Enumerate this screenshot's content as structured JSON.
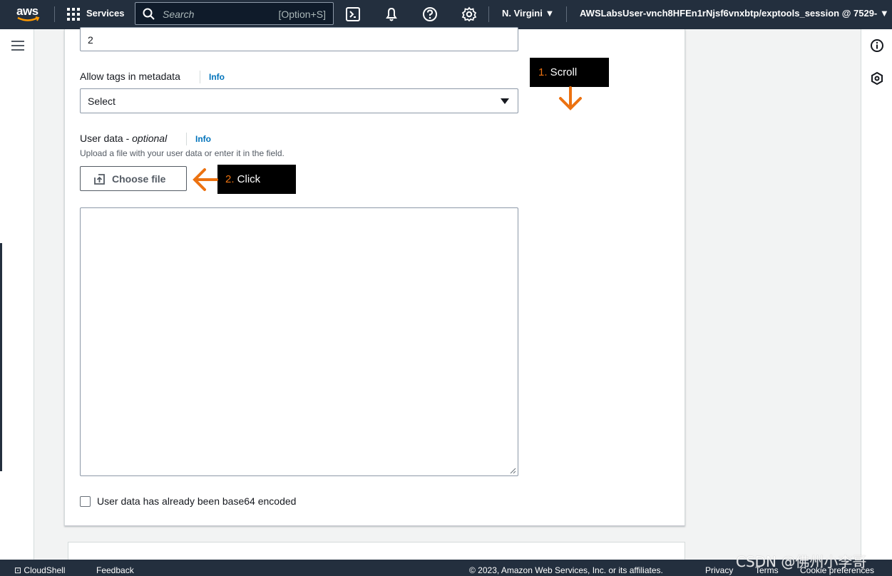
{
  "topnav": {
    "logo_text": "aws",
    "services_label": "Services",
    "search_placeholder": "Search",
    "search_shortcut": "[Option+S]",
    "region": "N. Virgini",
    "account": "AWSLabsUser-vnch8HFEn1rNjsf6vnxbtp/exptools_session @ 7529-"
  },
  "form": {
    "top_input_value": "2",
    "allow_tags_label": "Allow tags in metadata",
    "allow_tags_info": "Info",
    "allow_tags_select": "Select",
    "user_data_label": "User data - ",
    "user_data_optional": "optional",
    "user_data_info": "Info",
    "user_data_desc": "Upload a file with your user data or enter it in the field.",
    "choose_file_label": "Choose file",
    "user_data_value": "",
    "base64_checkbox_label": "User data has already been base64 encoded",
    "base64_checked": false
  },
  "annotations": {
    "scroll_num": "1.",
    "scroll_text": " Scroll",
    "click_num": "2.",
    "click_text": " Click",
    "accent_color": "#ec7211"
  },
  "footer": {
    "cloudshell": "CloudShell",
    "feedback": "Feedback",
    "copyright": "© 2023, Amazon Web Services, Inc. or its affiliates.",
    "privacy": "Privacy",
    "terms": "Terms",
    "cookie": "Cookie preferences"
  },
  "watermark": "CSDN @佛州小李哥",
  "icons": [
    "aws-logo",
    "services-grid-icon",
    "search-icon",
    "cloudshell-icon",
    "bell-icon",
    "help-icon",
    "gear-icon",
    "menu-icon",
    "info-icon",
    "hexagon-icon",
    "upload-icon",
    "caret-down-icon"
  ]
}
